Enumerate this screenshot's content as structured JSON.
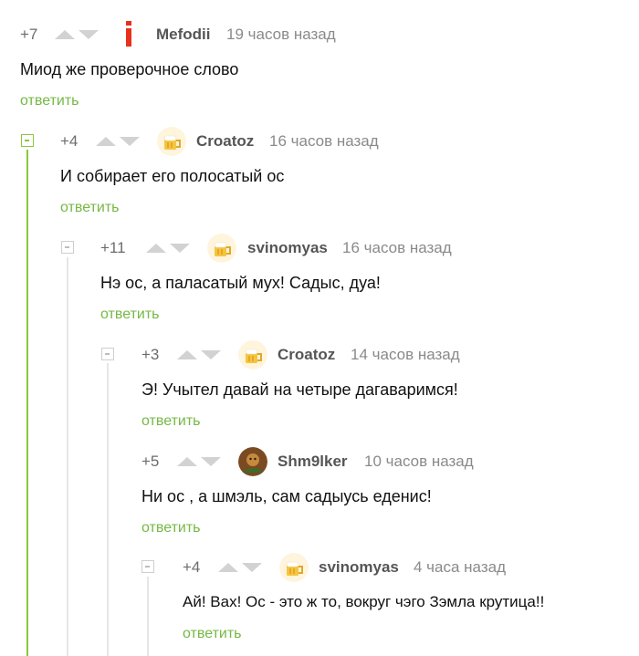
{
  "comments": [
    {
      "rating": "+7",
      "author": "Mefodii",
      "time": "19 часов назад",
      "text": "Миод же проверочное слово",
      "reply": "ответить",
      "avatar": "exclamation-avatar-icon"
    },
    {
      "rating": "+4",
      "author": "Croatoz",
      "time": "16 часов назад",
      "text": "И собирает его полосатый ос",
      "reply": "ответить",
      "avatar": "beer-mug-avatar-icon"
    },
    {
      "rating": "+11",
      "author": "svinomyas",
      "time": "16 часов назад",
      "text": "Нэ ос, а паласатый мух! Садыс, дуа!",
      "reply": "ответить",
      "avatar": "beer-mug-avatar-icon"
    },
    {
      "rating": "+3",
      "author": "Croatoz",
      "time": "14 часов назад",
      "text": "Э! Учытел давай на четыре дагаваримся!",
      "reply": "ответить",
      "avatar": "beer-mug-avatar-icon"
    },
    {
      "rating": "+5",
      "author": "Shm9lker",
      "time": "10 часов назад",
      "text": "Ни ос , а шмэль, сам садыусь еденис!",
      "reply": "ответить",
      "avatar": "photo-avatar-icon"
    },
    {
      "rating": "+4",
      "author": "svinomyas",
      "time": "4 часа назад",
      "text": "Ай! Вах! Ос - это ж то, вокруг чэго Зэмла крутица!!",
      "reply": "ответить",
      "avatar": "beer-mug-avatar-icon"
    }
  ],
  "colors": {
    "accent_green": "#76b844",
    "thread_line_active": "#8cc63f",
    "thread_line": "#e6e6e6",
    "mefodii_red": "#e8311b"
  }
}
